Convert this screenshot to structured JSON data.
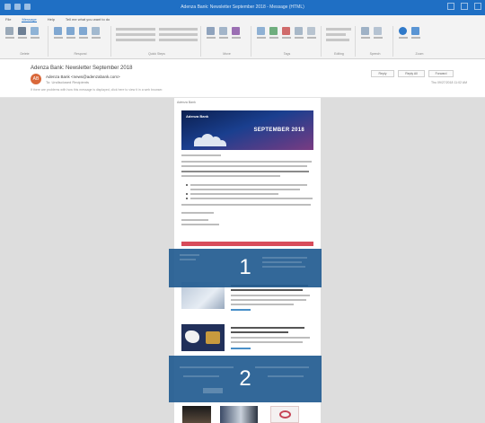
{
  "window": {
    "title": "Adenza Bank: Newsletter September 2018 - Message (HTML)"
  },
  "ribbon": {
    "tabs": [
      "File",
      "Message",
      "Help",
      "Tell me what you want to do"
    ],
    "groups": [
      "Delete",
      "Respond",
      "Quick Steps",
      "Move",
      "Tags",
      "Editing",
      "Speech",
      "Zoom"
    ]
  },
  "email": {
    "subject": "Adenza Bank: Newsletter September 2018",
    "sender": "Adenza Bank <news@adenzabank.com>",
    "to": "To: Undisclosed Recipients",
    "avatar_initials": "AB",
    "info_line": "If there are problems with how this message is displayed, click here to view it in a web browser.",
    "date": "Thu 09/27/2018 11:02 AM",
    "buttons": [
      "Reply",
      "Reply All",
      "Forward"
    ]
  },
  "newsletter": {
    "brand": "Adenza Bank",
    "banner_headline": "SEPTEMBER 2018"
  },
  "overlays": [
    {
      "number": "1"
    },
    {
      "number": "2"
    }
  ],
  "colors": {
    "titlebar": "#1f6fc4",
    "overlay": "#245c91",
    "red_bar": "#d84b5a"
  }
}
